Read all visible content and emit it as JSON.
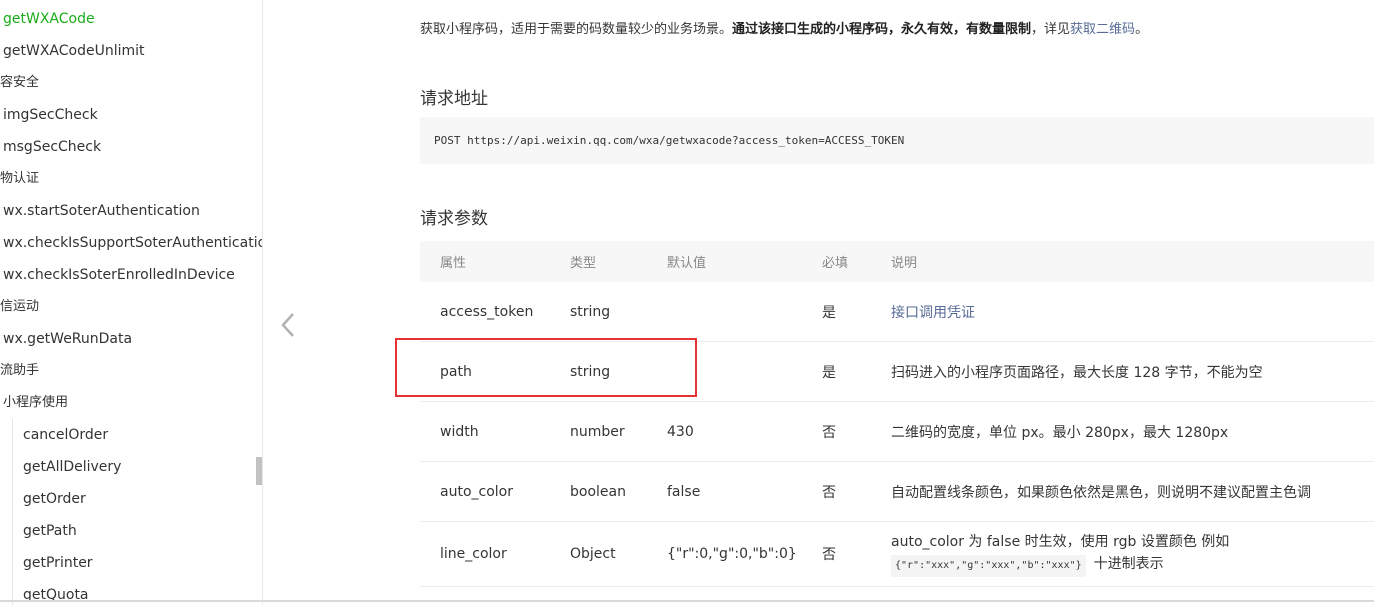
{
  "sidebar": {
    "items": [
      {
        "label": "getWXACode",
        "level": 1,
        "active": true
      },
      {
        "label": "getWXACodeUnlimit",
        "level": 1
      },
      {
        "label": "容安全",
        "level": 0
      },
      {
        "label": "imgSecCheck",
        "level": 1
      },
      {
        "label": "msgSecCheck",
        "level": 1
      },
      {
        "label": "物认证",
        "level": 0
      },
      {
        "label": "wx.startSoterAuthentication",
        "level": 1
      },
      {
        "label": "wx.checkIsSupportSoterAuthenticatio",
        "level": 1
      },
      {
        "label": "wx.checkIsSoterEnrolledInDevice",
        "level": 1
      },
      {
        "label": "信运动",
        "level": 0
      },
      {
        "label": "wx.getWeRunData",
        "level": 1
      },
      {
        "label": "流助手",
        "level": 0
      },
      {
        "label": "小程序使用",
        "level": 1
      },
      {
        "label": "cancelOrder",
        "level": 2
      },
      {
        "label": "getAllDelivery",
        "level": 2
      },
      {
        "label": "getOrder",
        "level": 2
      },
      {
        "label": "getPath",
        "level": 2
      },
      {
        "label": "getPrinter",
        "level": 2
      },
      {
        "label": "getQuota",
        "level": 2
      }
    ]
  },
  "intro": {
    "text1": "获取小程序码，适用于需要的码数量较少的业务场景。",
    "bold": "通过该接口生成的小程序码，永久有效，有数量限制",
    "text2": "，详见",
    "link": "获取二维码",
    "text3": "。"
  },
  "request_url": {
    "heading": "请求地址",
    "code": "POST https://api.weixin.qq.com/wxa/getwxacode?access_token=ACCESS_TOKEN"
  },
  "params": {
    "heading": "请求参数",
    "headers": [
      "属性",
      "类型",
      "默认值",
      "必填",
      "说明"
    ],
    "rows": [
      {
        "name": "access_token",
        "type": "string",
        "default": "",
        "required": "是",
        "desc": "接口调用凭证",
        "desc_is_link": true
      },
      {
        "name": "path",
        "type": "string",
        "default": "",
        "required": "是",
        "desc": "扫码进入的小程序页面路径，最大长度 128 字节，不能为空"
      },
      {
        "name": "width",
        "type": "number",
        "default": "430",
        "required": "否",
        "desc": "二维码的宽度，单位 px。最小 280px，最大 1280px"
      },
      {
        "name": "auto_color",
        "type": "boolean",
        "default": "false",
        "required": "否",
        "desc": "自动配置线条颜色，如果颜色依然是黑色，则说明不建议配置主色调"
      },
      {
        "name": "line_color",
        "type": "Object",
        "default": "{\"r\":0,\"g\":0,\"b\":0}",
        "required": "否",
        "desc": "auto_color 为 false 时生效，使用 rgb 设置颜色 例如",
        "desc_code": "{\"r\":\"xxx\",\"g\":\"xxx\",\"b\":\"xxx\"}",
        "desc_tail": "十进制表示"
      }
    ]
  },
  "icons": {
    "collapse": "chevron-left-icon"
  },
  "colors": {
    "accent": "#1aad19",
    "link": "#576b95",
    "highlight": "#e53333"
  }
}
